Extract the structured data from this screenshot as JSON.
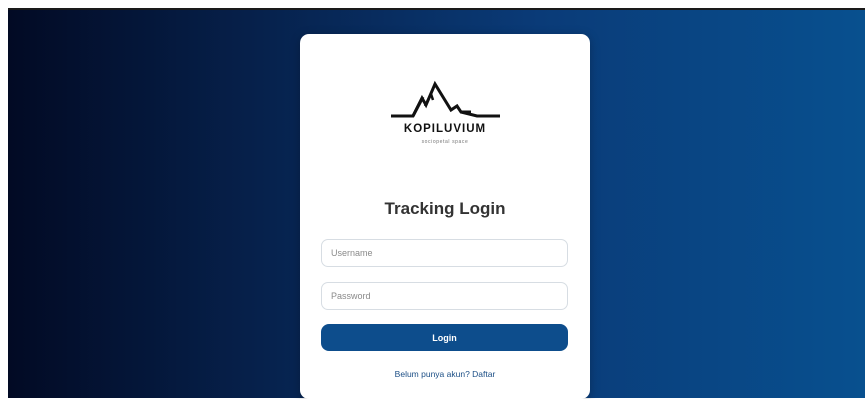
{
  "logo": {
    "brand": "KOPILUVIUM",
    "tagline": "sociopetal space",
    "icon": "mountain-logo-icon"
  },
  "login": {
    "title": "Tracking Login",
    "username_placeholder": "Username",
    "username_value": "",
    "password_placeholder": "Password",
    "password_value": "",
    "button_label": "Login",
    "register_text": "Belum punya akun? Daftar"
  },
  "colors": {
    "accent": "#0d4d8c",
    "background_dark": "#020a24",
    "background_light": "#08508f"
  }
}
